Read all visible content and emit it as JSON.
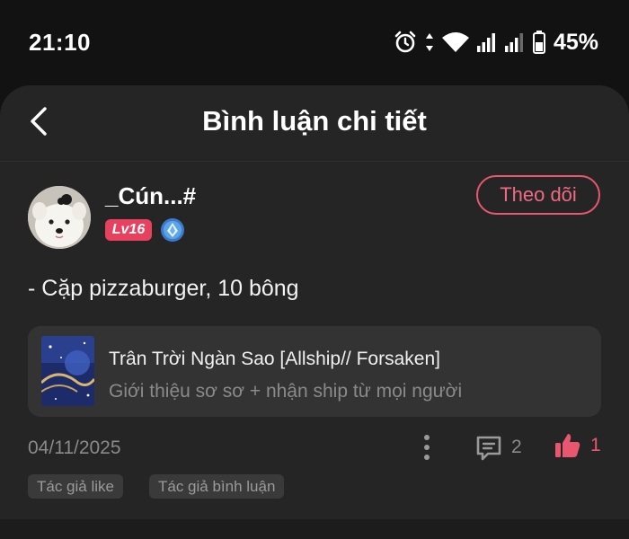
{
  "status_bar": {
    "time": "21:10",
    "battery_percent": "45%",
    "icons": [
      "alarm-icon",
      "data-arrows-icon",
      "wifi-icon",
      "signal-icon",
      "signal-icon",
      "battery-icon"
    ]
  },
  "header": {
    "title": "Bình luận chi tiết",
    "back_icon": "chevron-left-icon"
  },
  "comment": {
    "username": "_Cún...#",
    "level": "Lv16",
    "follow_label": "Theo dõi",
    "text": "- Cặp pizzaburger, 10 bông",
    "date": "04/11/2025",
    "comment_count": "2",
    "like_count": "1"
  },
  "book": {
    "title": "Trân Trời Ngàn Sao [Allship// Forsaken]",
    "description": "Giới thiệu sơ sơ + nhận ship từ mọi người"
  },
  "tags": [
    "Tác giả like",
    "Tác giả bình luận"
  ],
  "colors": {
    "accent": "#e8576f",
    "background": "#252525",
    "status_bar_bg": "#121212",
    "card_bg": "#333333",
    "muted_text": "#8a8a8a"
  }
}
